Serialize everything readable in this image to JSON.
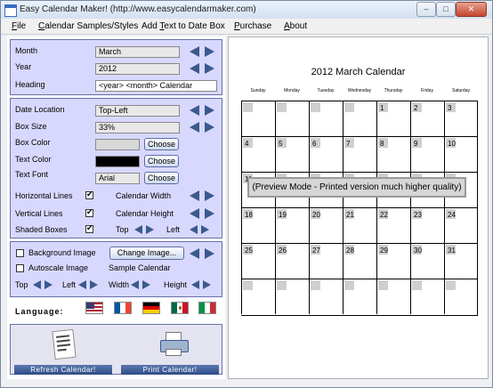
{
  "window": {
    "title": "Easy Calendar Maker! (http://www.easycalendarmaker.com)",
    "buttons": [
      "–",
      "□",
      "✕"
    ]
  },
  "menu": [
    {
      "label": "File",
      "u": "F",
      "rest": "ile"
    },
    {
      "label": "Calendar Samples/Styles",
      "u": "C",
      "rest": "alendar Samples/Styles"
    },
    {
      "label": "Add Text to Date Box",
      "pre": "Add ",
      "u": "T",
      "rest": "ext to Date Box"
    },
    {
      "label": "Purchase",
      "u": "P",
      "rest": "urchase"
    },
    {
      "label": "About",
      "u": "A",
      "rest": "bout"
    }
  ],
  "basics": {
    "month_label": "Month",
    "month_value": "March",
    "year_label": "Year",
    "year_value": "2012",
    "heading_label": "Heading",
    "heading_value": "<year> <month> Calendar"
  },
  "layout": {
    "date_location_label": "Date Location",
    "date_location_value": "Top-Left",
    "box_size_label": "Box Size",
    "box_size_value": "33%",
    "box_color_label": "Box Color",
    "text_color_label": "Text Color",
    "text_font_label": "Text Font",
    "text_font_value": "Arial",
    "choose_label": "Choose",
    "horizontal_lines_label": "Horizontal Lines",
    "horizontal_lines_checked": true,
    "vertical_lines_label": "Vertical Lines",
    "vertical_lines_checked": true,
    "shaded_boxes_label": "Shaded Boxes",
    "shaded_boxes_checked": true,
    "calendar_width_label": "Calendar Width",
    "calendar_height_label": "Calendar Height",
    "top_label": "Top",
    "left_label": "Left",
    "box_color": "#d8d8d8",
    "text_color": "#000000"
  },
  "image": {
    "background_image_label": "Background Image",
    "autoscale_image_label": "Autoscale Image",
    "change_image_label": "Change Image...",
    "sample_calendar_label": "Sample Calendar",
    "top_label": "Top",
    "left_label": "Left",
    "width_label": "Width",
    "height_label": "Height"
  },
  "language": {
    "label": "Language:",
    "flags": [
      "us-flag-icon",
      "france-flag-icon",
      "germany-flag-icon",
      "mexico-flag-icon",
      "italy-flag-icon"
    ]
  },
  "actions": {
    "refresh_label": "Refresh Calendar!",
    "print_label": "Print Calendar!"
  },
  "calendar": {
    "title": "2012 March Calendar",
    "days": [
      "Sunday",
      "Monday",
      "Tuesday",
      "Wednesday",
      "Thursday",
      "Friday",
      "Saturday"
    ],
    "weeks": [
      [
        "",
        "",
        "",
        "",
        "1",
        "2",
        "3"
      ],
      [
        "4",
        "5",
        "6",
        "7",
        "8",
        "9",
        "10"
      ],
      [
        "11",
        "",
        "",
        "",
        "",
        "",
        ""
      ],
      [
        "18",
        "19",
        "20",
        "21",
        "22",
        "23",
        "24"
      ],
      [
        "25",
        "26",
        "27",
        "28",
        "29",
        "30",
        "31"
      ],
      [
        "",
        "",
        "",
        "",
        "",
        "",
        ""
      ]
    ],
    "preview_message": "(Preview Mode - Printed version much higher quality)"
  },
  "colors": {
    "panel": "#d8d8ff",
    "arrow": "#3b5a8c",
    "button_bar": "#2d4b86"
  }
}
